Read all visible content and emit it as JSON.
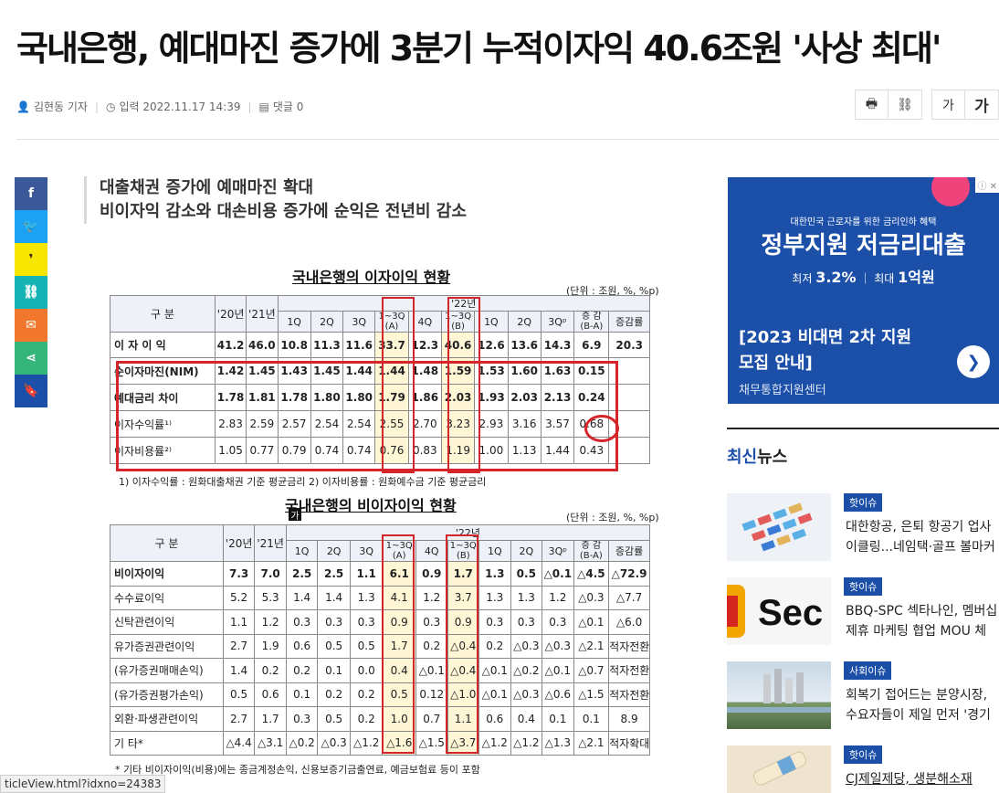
{
  "article": {
    "headline": "국내은행, 예대마진 증가에 3분기 누적이자익 40.6조원 '사상 최대'",
    "author": "김현동 기자",
    "date": "입력 2022.11.17 14:39",
    "comments": "댓글 0",
    "subtitle1": "대출채권 증가에 예매마진 확대",
    "subtitle2": "비이자익 감소와 대손비용 증가에 순익은 전년비 감소"
  },
  "tools": {
    "print_icon": "print-icon",
    "link_icon": "link-icon",
    "font_small": "가",
    "font_large": "가"
  },
  "share": [
    "facebook-icon",
    "twitter-icon",
    "kakao-icon",
    "link-icon",
    "mail-icon",
    "share-icon",
    "bookmark-icon"
  ],
  "colors": {
    "facebook": "#3b5998",
    "twitter": "#1da1f2",
    "kakao": "#f7e600",
    "link": "#15b3b3",
    "mail": "#f0772b",
    "share": "#35b57a",
    "bookmark": "#1b4fa8",
    "accent": "#1b4fa8",
    "highlight": "#d6242b"
  },
  "t1": {
    "title": "국내은행의 이자이익 현황",
    "unit": "(단위 : 조원, %, %p)",
    "head_gubun": "구 분",
    "h20": "'20년",
    "h21": "'21년",
    "h22": "'22년",
    "q1": "1Q",
    "q2": "2Q",
    "q3": "3Q",
    "q13a": "1~3Q (A)",
    "q4": "4Q",
    "q13b": "1~3Q (B)",
    "q1b": "1Q",
    "q2b": "2Q",
    "q3p": "3Qᵖ",
    "chg": "증 감 (B-A)",
    "rate": "증감률",
    "rows": [
      [
        "이 자 이 익",
        "41.2",
        "46.0",
        "10.8",
        "11.3",
        "11.6",
        "33.7",
        "12.3",
        "40.6",
        "12.6",
        "13.6",
        "14.3",
        "6.9",
        "20.3"
      ],
      [
        "순이자마진(NIM)",
        "1.42",
        "1.45",
        "1.43",
        "1.45",
        "1.44",
        "1.44",
        "1.48",
        "1.59",
        "1.53",
        "1.60",
        "1.63",
        "0.15",
        ""
      ],
      [
        "예대금리 차이",
        "1.78",
        "1.81",
        "1.78",
        "1.80",
        "1.80",
        "1.79",
        "1.86",
        "2.03",
        "1.93",
        "2.03",
        "2.13",
        "0.24",
        ""
      ],
      [
        "이자수익률¹⁾",
        "2.83",
        "2.59",
        "2.57",
        "2.54",
        "2.54",
        "2.55",
        "2.70",
        "3.23",
        "2.93",
        "3.16",
        "3.57",
        "0.68",
        ""
      ],
      [
        "이자비용률²⁾",
        "1.05",
        "0.77",
        "0.79",
        "0.74",
        "0.74",
        "0.76",
        "0.83",
        "1.19",
        "1.00",
        "1.13",
        "1.44",
        "0.43",
        ""
      ]
    ],
    "note": "1) 이자수익률 : 원화대출채권 기준 평균금리          2) 이자비용률 : 원화예수금 기준 평균금리"
  },
  "t2": {
    "title": "국내은행의 비이자이익 현황",
    "unit": "(단위 : 조원, %, %p)",
    "hm": "가",
    "rows": [
      [
        "비이자이익",
        "7.3",
        "7.0",
        "2.5",
        "2.5",
        "1.1",
        "6.1",
        "0.9",
        "1.7",
        "1.3",
        "0.5",
        "△0.1",
        "△4.5",
        "△72.9"
      ],
      [
        "수수료이익",
        "5.2",
        "5.3",
        "1.4",
        "1.4",
        "1.3",
        "4.1",
        "1.2",
        "3.7",
        "1.3",
        "1.3",
        "1.2",
        "△0.3",
        "△7.7"
      ],
      [
        "신탁관련이익",
        "1.1",
        "1.2",
        "0.3",
        "0.3",
        "0.3",
        "0.9",
        "0.3",
        "0.9",
        "0.3",
        "0.3",
        "0.3",
        "△0.1",
        "△6.0"
      ],
      [
        "유가증권관련이익",
        "2.7",
        "1.9",
        "0.6",
        "0.5",
        "0.5",
        "1.7",
        "0.2",
        "△0.4",
        "0.2",
        "△0.3",
        "△0.3",
        "△2.1",
        "적자전환"
      ],
      [
        "(유가증권매매손익)",
        "1.4",
        "0.2",
        "0.2",
        "0.1",
        "0.0",
        "0.4",
        "△0.1",
        "△0.4",
        "△0.1",
        "△0.2",
        "△0.1",
        "△0.7",
        "적자전환"
      ],
      [
        "(유가증권평가손익)",
        "0.5",
        "0.6",
        "0.1",
        "0.2",
        "0.2",
        "0.5",
        "0.12",
        "△1.0",
        "△0.1",
        "△0.3",
        "△0.6",
        "△1.5",
        "적자전환"
      ],
      [
        "외환·파생관련이익",
        "2.7",
        "1.7",
        "0.3",
        "0.5",
        "0.2",
        "1.0",
        "0.7",
        "1.1",
        "0.6",
        "0.4",
        "0.1",
        "0.1",
        "8.9"
      ],
      [
        "기 타*",
        "△4.4",
        "△3.1",
        "△0.2",
        "△0.3",
        "△1.2",
        "△1.6",
        "△1.5",
        "△3.7",
        "△1.2",
        "△1.2",
        "△1.3",
        "△2.1",
        "적자확대"
      ]
    ],
    "note": "* 기타 비이자이익(비용)에는 종금계정손익, 신용보증기금출연료, 예금보험료 등이 포함"
  },
  "ad": {
    "small": "대한민국 근로자를 위한 금리인하 혜택",
    "main": "정부지원 저금리대출",
    "rate_label": "최저",
    "rate": "3.2%",
    "limit_label": "최대",
    "limit": "1억원",
    "title1": "[2023 비대면 2차 지원",
    "title2": "모집 안내]",
    "sponsor": "채무통합지원센터",
    "badge": "ⓘ ✕"
  },
  "news": {
    "head_a": "최신",
    "head_b": "뉴스",
    "items": [
      {
        "tag": "핫이슈",
        "line1": "대한항공, 은퇴 항공기 업사",
        "line2": "이클링...네임택·골프 볼마커"
      },
      {
        "tag": "핫이슈",
        "line1": "BBQ-SPC 섹타나인, 멤버십",
        "line2": "제휴 마케팅 협업 MOU 체"
      },
      {
        "tag": "사회이슈",
        "line1": "회복기 접어드는 분양시장,",
        "line2": "수요자들이 제일 먼저 '경기"
      },
      {
        "tag": "핫이슈",
        "line1": "CJ제일제당, 생분해소재",
        "line2": ""
      }
    ]
  },
  "status": "ticleView.html?idxno=24383"
}
